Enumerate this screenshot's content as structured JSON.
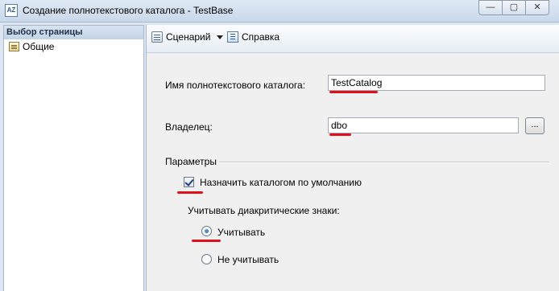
{
  "window": {
    "app_icon": "AZ",
    "title": "Создание полнотекстового каталога - TestBase",
    "controls": {
      "minimize": "—",
      "maximize": "▢",
      "close": "✕"
    }
  },
  "sidebar": {
    "header": "Выбор страницы",
    "items": [
      {
        "label": "Общие",
        "icon": "page-properties-icon"
      }
    ]
  },
  "toolbar": {
    "script_label": "Сценарий",
    "help_label": "Справка"
  },
  "form": {
    "catalog_name_label": "Имя полнотекстового каталога:",
    "catalog_name_value": "TestCatalog",
    "owner_label": "Владелец:",
    "owner_value": "dbo",
    "browse_label": "...",
    "parameters_title": "Параметры",
    "default_catalog_label": "Назначить каталогом по умолчанию",
    "default_catalog_checked": true,
    "accent_label": "Учитывать диакритические знаки:",
    "accent_options": [
      {
        "label": "Учитывать",
        "selected": true
      },
      {
        "label": "Не учитывать",
        "selected": false
      }
    ]
  },
  "colors": {
    "annotation_underline": "#e0101a",
    "titlebar": "#c9d8ea",
    "panel": "#f0f0f0"
  }
}
